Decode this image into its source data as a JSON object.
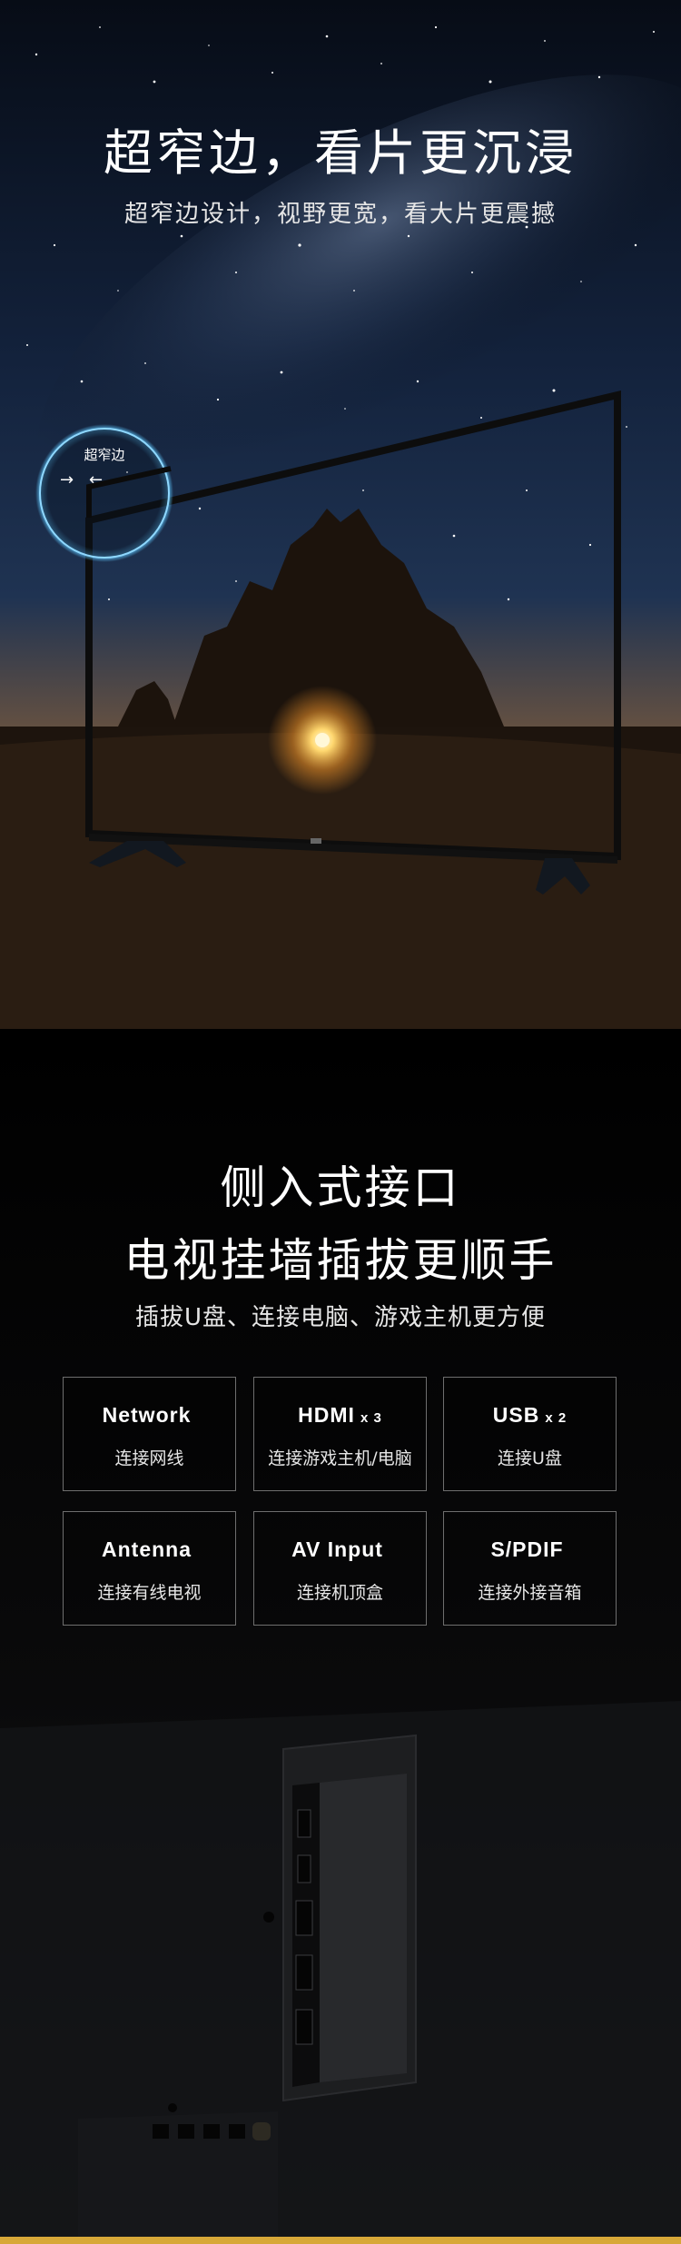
{
  "hero": {
    "title": "超窄边，看片更沉浸",
    "subtitle": "超窄边设计，视野更宽，看大片更震撼",
    "bezel_label": "超窄边",
    "arrow_left": "→",
    "arrow_right": "←"
  },
  "ports": {
    "title_line1": "侧入式接口",
    "title_line2": "电视挂墙插拔更顺手",
    "subtitle": "插拔U盘、连接电脑、游戏主机更方便",
    "items": [
      {
        "name": "Network",
        "count": "",
        "desc": "连接网线"
      },
      {
        "name": "HDMI",
        "count": "x 3",
        "desc": "连接游戏主机/电脑"
      },
      {
        "name": "USB",
        "count": "x 2",
        "desc": "连接U盘"
      },
      {
        "name": "Antenna",
        "count": "",
        "desc": "连接有线电视"
      },
      {
        "name": "AV Input",
        "count": "",
        "desc": "连接机顶盒"
      },
      {
        "name": "S/PDIF",
        "count": "",
        "desc": "连接外接音箱"
      }
    ]
  },
  "colors": {
    "sky_top": "#0b1424",
    "horizon_glow": "#f2a03a",
    "sun": "#fff2a8",
    "badge_ring": "#5ec8ff",
    "card_border": "#6e6e6e",
    "accent_bar": "#d8a838"
  }
}
